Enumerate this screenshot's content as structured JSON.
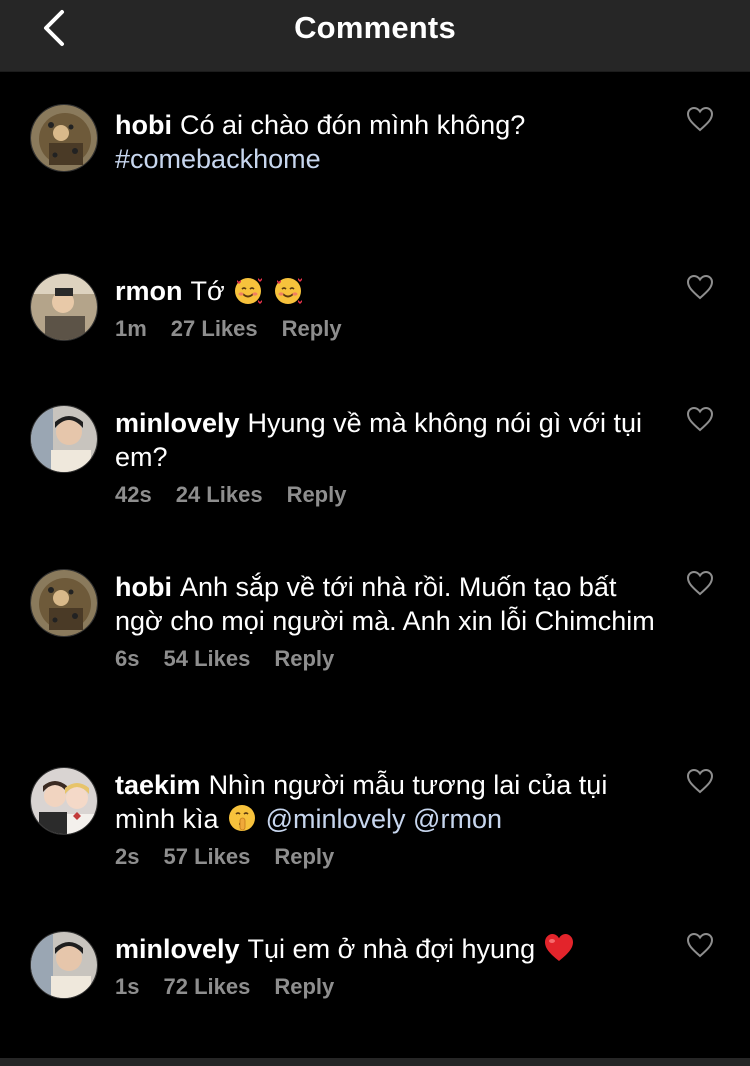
{
  "header": {
    "title": "Comments"
  },
  "comments": [
    {
      "user": "hobi",
      "text": "Có ai chào đón mình không?",
      "tag": "#comebackhome"
    },
    {
      "user": "rmon",
      "text": "Tớ",
      "time": "1m",
      "likes": "27 Likes",
      "reply": "Reply"
    },
    {
      "user": "minlovely",
      "text": "Hyung về mà không nói gì với tụi em?",
      "time": "42s",
      "likes": "24 Likes",
      "reply": "Reply"
    },
    {
      "user": "hobi",
      "text": "Anh sắp về tới nhà rồi. Muốn tạo bất ngờ cho mọi người mà. Anh xin lỗi Chimchim",
      "time": "6s",
      "likes": "54 Likes",
      "reply": "Reply"
    },
    {
      "user": "taekim",
      "text": "Nhìn người mẫu tương lai của tụi mình kìa",
      "mention1": "@minlovely",
      "mention2": "@rmon",
      "time": "2s",
      "likes": "57 Likes",
      "reply": "Reply"
    },
    {
      "user": "minlovely",
      "text": "Tụi em ở nhà đợi hyung",
      "time": "1s",
      "likes": "72 Likes",
      "reply": "Reply"
    }
  ],
  "icons": {
    "back": "chevron-left-icon",
    "heart": "heart-outline-icon",
    "emoji_love": "smiling-face-with-hearts-icon",
    "emoji_shush": "shushing-face-icon",
    "emoji_heart": "red-heart-icon"
  },
  "colors": {
    "background": "#000000",
    "header": "#262626",
    "meta": "#8e8e8e",
    "hashtag": "#c7d6ee"
  }
}
